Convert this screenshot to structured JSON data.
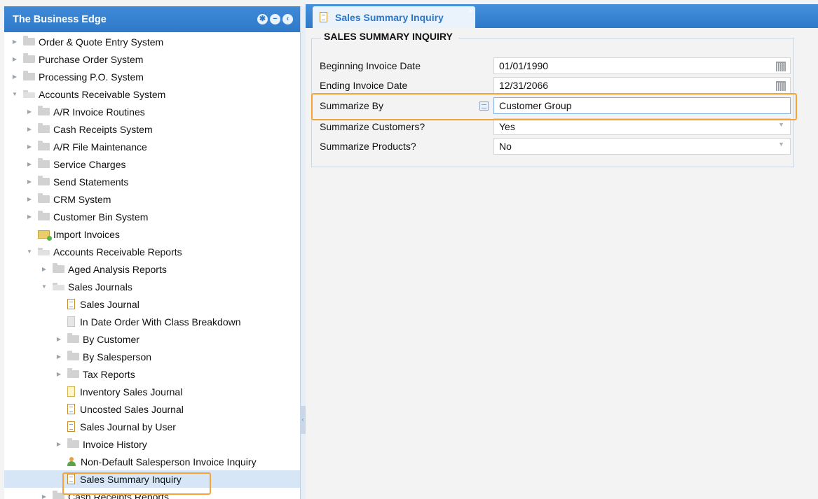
{
  "sidebar": {
    "title": "The Business Edge",
    "header_icons": [
      "gear-icon",
      "collapse-icon",
      "back-icon"
    ],
    "items": [
      {
        "label": "Order & Quote Entry System",
        "indent": 0,
        "type": "folder",
        "state": "collapsed"
      },
      {
        "label": "Purchase Order System",
        "indent": 0,
        "type": "folder",
        "state": "collapsed"
      },
      {
        "label": "Processing P.O. System",
        "indent": 0,
        "type": "folder",
        "state": "collapsed"
      },
      {
        "label": "Accounts Receivable System",
        "indent": 0,
        "type": "folder",
        "state": "expanded"
      },
      {
        "label": "A/R Invoice Routines",
        "indent": 1,
        "type": "folder",
        "state": "collapsed"
      },
      {
        "label": "Cash Receipts System",
        "indent": 1,
        "type": "folder",
        "state": "collapsed"
      },
      {
        "label": "A/R File Maintenance",
        "indent": 1,
        "type": "folder",
        "state": "collapsed"
      },
      {
        "label": "Service Charges",
        "indent": 1,
        "type": "folder",
        "state": "collapsed"
      },
      {
        "label": "Send Statements",
        "indent": 1,
        "type": "folder",
        "state": "collapsed"
      },
      {
        "label": "CRM System",
        "indent": 1,
        "type": "folder",
        "state": "collapsed"
      },
      {
        "label": "Customer Bin System",
        "indent": 1,
        "type": "folder",
        "state": "collapsed"
      },
      {
        "label": "Import Invoices",
        "indent": 1,
        "type": "import"
      },
      {
        "label": "Accounts Receivable Reports",
        "indent": 1,
        "type": "folder",
        "state": "expanded"
      },
      {
        "label": "Aged Analysis Reports",
        "indent": 2,
        "type": "folder",
        "state": "collapsed"
      },
      {
        "label": "Sales Journals",
        "indent": 2,
        "type": "folder",
        "state": "expanded"
      },
      {
        "label": "Sales Journal",
        "indent": 3,
        "type": "doc"
      },
      {
        "label": "In Date Order With Class Breakdown",
        "indent": 3,
        "type": "doc-grey"
      },
      {
        "label": "By Customer",
        "indent": 3,
        "type": "folder",
        "state": "collapsed"
      },
      {
        "label": "By Salesperson",
        "indent": 3,
        "type": "folder",
        "state": "collapsed"
      },
      {
        "label": "Tax Reports",
        "indent": 3,
        "type": "folder",
        "state": "collapsed"
      },
      {
        "label": "Inventory Sales Journal",
        "indent": 3,
        "type": "doc-yellow"
      },
      {
        "label": "Uncosted Sales Journal",
        "indent": 3,
        "type": "doc"
      },
      {
        "label": "Sales Journal by User",
        "indent": 3,
        "type": "doc"
      },
      {
        "label": "Invoice History",
        "indent": 3,
        "type": "folder",
        "state": "collapsed"
      },
      {
        "label": "Non-Default Salesperson Invoice Inquiry",
        "indent": 3,
        "type": "person"
      },
      {
        "label": "Sales Summary Inquiry",
        "indent": 3,
        "type": "doc",
        "selected": true
      },
      {
        "label": "Cash Receipts Reports",
        "indent": 2,
        "type": "folder",
        "state": "collapsed"
      }
    ]
  },
  "tab": {
    "title": "Sales Summary Inquiry",
    "close": "×"
  },
  "form": {
    "legend": "SALES SUMMARY INQUIRY",
    "beginning_date_label": "Beginning Invoice Date",
    "beginning_date_value": "01/01/1990",
    "ending_date_label": "Ending Invoice Date",
    "ending_date_value": "12/31/2066",
    "summarize_by_label": "Summarize By",
    "summarize_by_value": "Customer Group",
    "summarize_customers_label": "Summarize Customers?",
    "summarize_customers_value": "Yes",
    "summarize_products_label": "Summarize Products?",
    "summarize_products_value": "No"
  },
  "colors": {
    "header_blue": "#2f79c9",
    "highlight_orange": "#f6a43a",
    "selected_row": "#d6e6f7"
  }
}
